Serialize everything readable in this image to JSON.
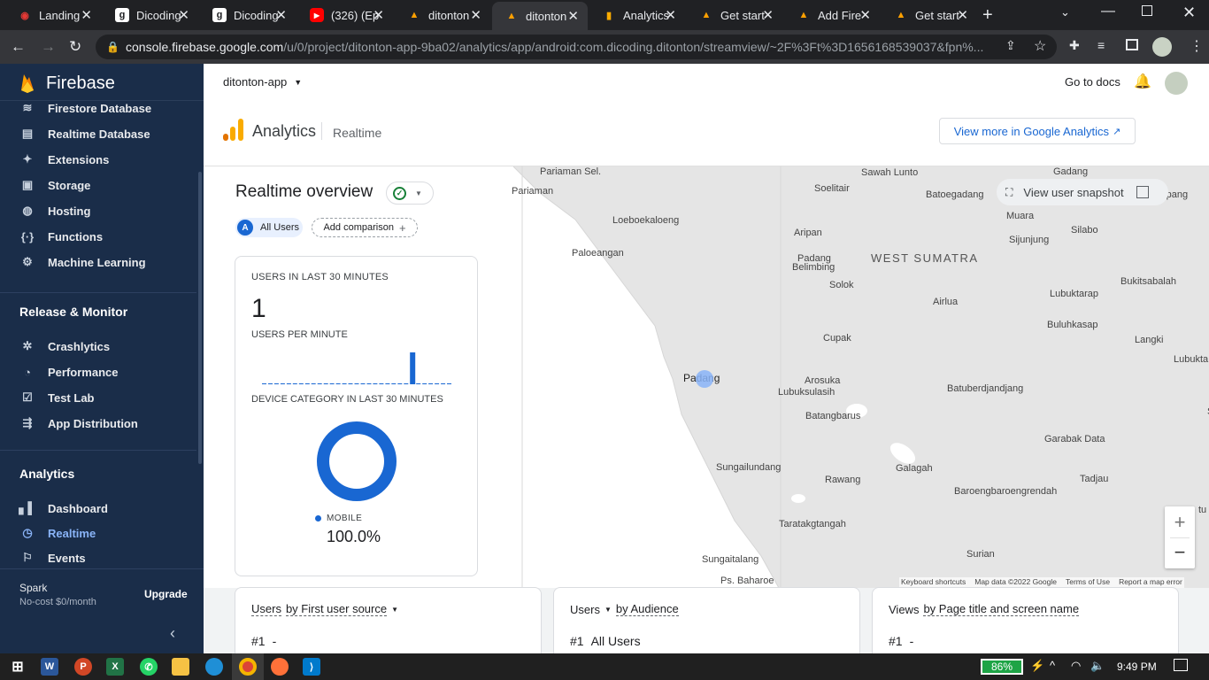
{
  "browser": {
    "tabs": [
      {
        "title": "Landing",
        "favicon": "wifi-icon",
        "color": "#e53935"
      },
      {
        "title": "Dicoding",
        "favicon": "dicoding-icon",
        "color": "#ffffff"
      },
      {
        "title": "Dicoding",
        "favicon": "dicoding-icon",
        "color": "#ffffff"
      },
      {
        "title": "(326) (Ep",
        "favicon": "youtube-icon",
        "color": "#ff0000"
      },
      {
        "title": "ditonton",
        "favicon": "firebase-icon",
        "color": "#ffa000"
      },
      {
        "title": "ditonton",
        "favicon": "firebase-icon",
        "color": "#ffa000"
      },
      {
        "title": "Analytics",
        "favicon": "analytics-icon",
        "color": "#f9ab00"
      },
      {
        "title": "Get start",
        "favicon": "firebase-icon",
        "color": "#ffa000"
      },
      {
        "title": "Add Fire",
        "favicon": "firebase-icon",
        "color": "#ffa000"
      },
      {
        "title": "Get start",
        "favicon": "firebase-icon",
        "color": "#ffa000"
      }
    ],
    "active_tab": 5,
    "url_host": "console.firebase.google.com",
    "url_path": "/u/0/project/ditonton-app-9ba02/analytics/app/android:com.dicoding.ditonton/streamview/~2F%3Ft%3D1656168539037&fpn%..."
  },
  "sidebar": {
    "brand": "Firebase",
    "build_items": [
      {
        "label": "Firestore Database",
        "icon": "firestore-icon"
      },
      {
        "label": "Realtime Database",
        "icon": "realtime-database-icon"
      },
      {
        "label": "Extensions",
        "icon": "extensions-icon"
      },
      {
        "label": "Storage",
        "icon": "storage-icon"
      },
      {
        "label": "Hosting",
        "icon": "hosting-icon"
      },
      {
        "label": "Functions",
        "icon": "functions-icon"
      },
      {
        "label": "Machine Learning",
        "icon": "machine-learning-icon"
      }
    ],
    "release_heading": "Release & Monitor",
    "release_items": [
      {
        "label": "Crashlytics",
        "icon": "crashlytics-icon"
      },
      {
        "label": "Performance",
        "icon": "performance-icon"
      },
      {
        "label": "Test Lab",
        "icon": "test-lab-icon"
      },
      {
        "label": "App Distribution",
        "icon": "app-distribution-icon"
      }
    ],
    "analytics_heading": "Analytics",
    "analytics_items": [
      {
        "label": "Dashboard",
        "icon": "dashboard-icon"
      },
      {
        "label": "Realtime",
        "icon": "realtime-icon"
      },
      {
        "label": "Events",
        "icon": "events-icon"
      }
    ],
    "plan_name": "Spark",
    "plan_desc": "No-cost $0/month",
    "upgrade_label": "Upgrade"
  },
  "header": {
    "project": "ditonton-app",
    "docs_label": "Go to docs",
    "analytics_title": "Analytics",
    "realtime_label": "Realtime",
    "view_more_label": "View more in Google Analytics"
  },
  "overview": {
    "title": "Realtime overview",
    "all_users_badge": "A",
    "all_users_label": "All Users",
    "add_comparison_label": "Add comparison",
    "view_snapshot_label": "View user snapshot"
  },
  "users_card": {
    "users_heading": "USERS IN LAST 30 MINUTES",
    "users_count": "1",
    "per_minute_heading": "USERS PER MINUTE",
    "per_minute_values": [
      0,
      0,
      0,
      0,
      0,
      0,
      0,
      0,
      0,
      0,
      0,
      0,
      0,
      0,
      0,
      0,
      0,
      0,
      0,
      0,
      0,
      0,
      0,
      0,
      1,
      0,
      0,
      0,
      0,
      0,
      0
    ],
    "device_heading": "DEVICE CATEGORY IN LAST 30 MINUTES",
    "device_legend": "MOBILE",
    "device_percent": "100.0%",
    "device_share": 1.0,
    "accent": "#1967d2"
  },
  "map": {
    "labels": [
      "Pariaman Sel.",
      "Sawah Lunto",
      "Gadang",
      "Pariaman",
      "Soelitair",
      "Batoegadang",
      "impang",
      "Loeboekaloeng",
      "Muara",
      "Silabo",
      "Aripan",
      "Sijunjung",
      "Paloeangan",
      "Padang",
      "Belimbing",
      "WEST SUMATRA",
      "Bukitsabalah",
      "Solok",
      "Lubuktarap",
      "Airlua",
      "Buluhkasap",
      "Cupak",
      "Langki",
      "Lubukta",
      "Padang",
      "Arosuka",
      "Batuberdjandjang",
      "Lubuksulasih",
      "Silago",
      "Batangbarus",
      "Garabak Data",
      "Sungailundang",
      "Galagah",
      "Tadjau",
      "Rawang",
      "Baroengbaroengrendah",
      "tu",
      "Taratakgtangah",
      "Sungaitalang",
      "Surian",
      "Ps. Baharoe"
    ],
    "footer": [
      "Keyboard shortcuts",
      "Map data ©2022 Google",
      "Terms of Use",
      "Report a map error"
    ],
    "zoom_in": "+",
    "zoom_out": "−"
  },
  "bottom_cards": [
    {
      "title_a": "Users",
      "title_b": "by First user source",
      "rank": "#1",
      "value": "-"
    },
    {
      "title_a": "Users",
      "title_b": "by Audience",
      "rank": "#1",
      "value": "All Users"
    },
    {
      "title_a": "Views",
      "title_b": "by Page title and screen name",
      "rank": "#1",
      "value": "-"
    }
  ],
  "taskbar": {
    "battery": "86%",
    "time": "9:49 PM"
  }
}
